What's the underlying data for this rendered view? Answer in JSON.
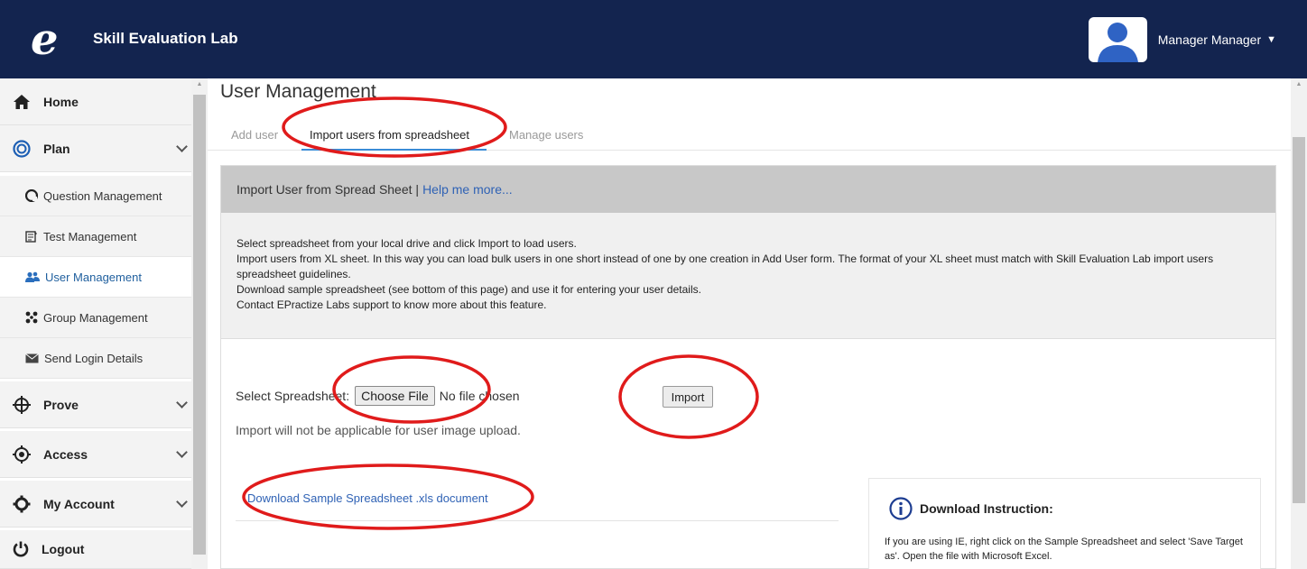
{
  "header": {
    "app_title": "Skill Evaluation Lab",
    "user_name": "Manager Manager"
  },
  "sidebar": {
    "items": [
      {
        "label": "Home",
        "icon": "home-icon"
      },
      {
        "label": "Plan",
        "icon": "target-icon"
      },
      {
        "label": "Question Management",
        "icon": "question-icon"
      },
      {
        "label": "Test Management",
        "icon": "test-icon"
      },
      {
        "label": "User Management",
        "icon": "users-icon"
      },
      {
        "label": "Group Management",
        "icon": "group-icon"
      },
      {
        "label": "Send Login Details",
        "icon": "envelope-icon"
      },
      {
        "label": "Prove",
        "icon": "crosshair-icon"
      },
      {
        "label": "Access",
        "icon": "access-icon"
      },
      {
        "label": "My Account",
        "icon": "gear-icon"
      },
      {
        "label": "Logout",
        "icon": "power-icon"
      }
    ]
  },
  "main": {
    "title": "User Management",
    "tabs": [
      {
        "label": "Add user"
      },
      {
        "label": "Import users from spreadsheet"
      },
      {
        "label": "Manage users"
      }
    ],
    "panel": {
      "heading": "Import User from Spread Sheet |",
      "help_link": "Help me more...",
      "info_lines": [
        "Select spreadsheet from your local drive and click Import to load users.",
        "Import users from XL sheet. In this way you can load bulk users in one short instead of one by one creation in Add User form. The format of your XL sheet must match with Skill Evaluation Lab import users spreadsheet guidelines.",
        "Download sample spreadsheet (see bottom of this page) and use it for entering your user details.",
        "Contact EPractize Labs support to know more about this feature."
      ],
      "select_label": "Select Spreadsheet:",
      "choose_file": "Choose File",
      "no_file": "No file chosen",
      "import_button": "Import",
      "note": "Import will not be applicable for user image upload.",
      "download_link": "Download Sample Spreadsheet .xls document"
    },
    "instruction": {
      "title": "Download Instruction:",
      "text": "If you are using IE, right click on the Sample Spreadsheet and select 'Save Target as'. Open the file with Microsoft Excel."
    }
  },
  "colors": {
    "header_bg": "#13244f",
    "link": "#2f62b5",
    "annotation": "#e01b1b",
    "tab_active": "#3a8cd6"
  }
}
